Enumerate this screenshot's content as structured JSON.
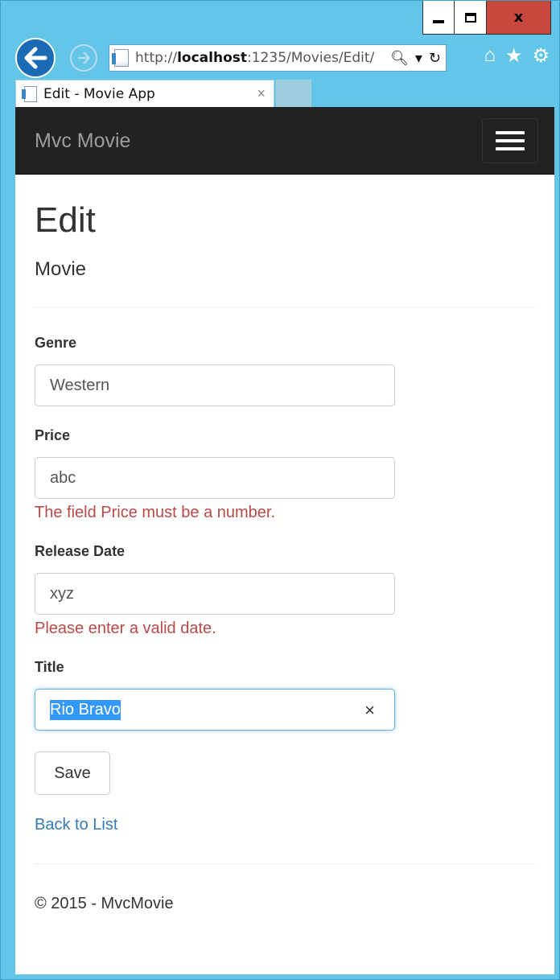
{
  "browser": {
    "address_prefix": "http://",
    "address_host": "localhost",
    "address_rest": ":1235/Movies/Edit/",
    "tab_title": "Edit - Movie App",
    "tab_close": "×",
    "window_close": "x",
    "accent_color": "#63c6e9"
  },
  "app": {
    "brand": "Mvc Movie"
  },
  "page": {
    "title": "Edit",
    "subtitle": "Movie"
  },
  "form": {
    "genre": {
      "label": "Genre",
      "value": "Western"
    },
    "price": {
      "label": "Price",
      "value": "abc",
      "error": "The field Price must be a number."
    },
    "release_date": {
      "label": "Release Date",
      "value": "xyz",
      "error": "Please enter a valid date."
    },
    "title": {
      "label": "Title",
      "value": "Rio Bravo",
      "clear": "×"
    },
    "save_label": "Save"
  },
  "links": {
    "back": "Back to List"
  },
  "footer": {
    "text": "© 2015 - MvcMovie"
  },
  "colors": {
    "navbar": "#222222",
    "error": "#b94a48",
    "link": "#337ab7",
    "focus": "#66afe9"
  }
}
